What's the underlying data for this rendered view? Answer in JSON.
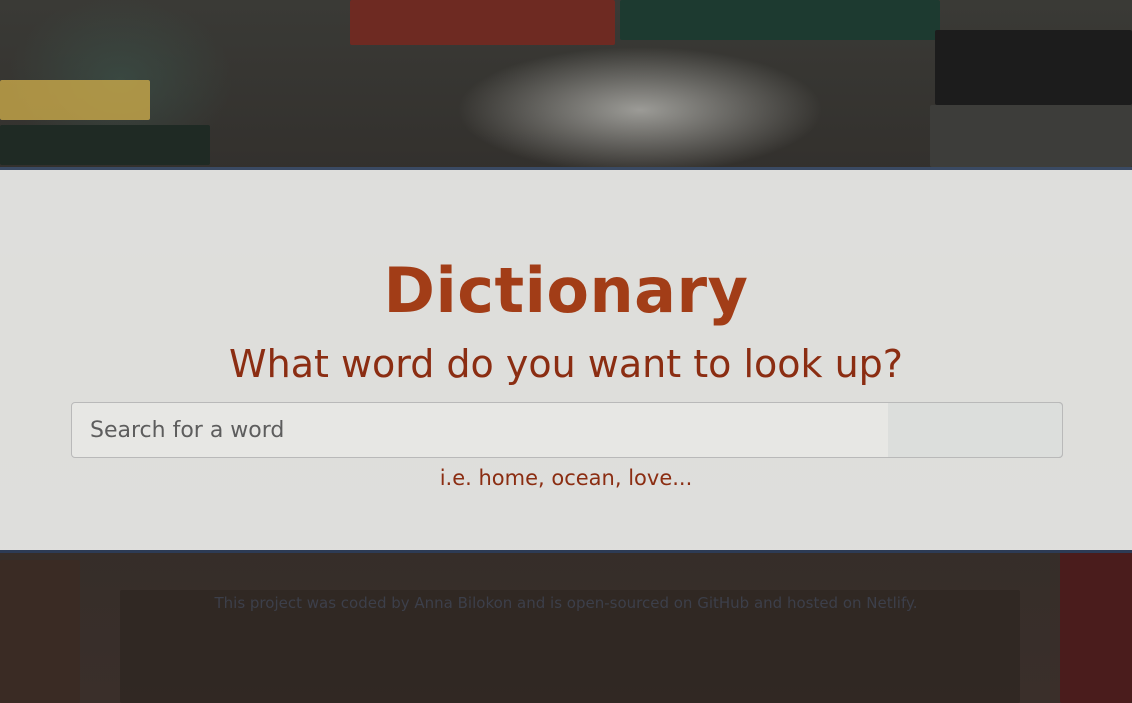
{
  "header": {
    "title": "Dictionary",
    "subtitle": "What word do you want to look up?"
  },
  "search": {
    "placeholder": "Search for a word",
    "value": ""
  },
  "hint": "i.e. home, ocean, love...",
  "footer": {
    "prefix": "This project was coded by ",
    "author_link": "Anna Bilokon",
    "middle": " and is ",
    "github_link": "open-sourced on GitHub",
    "middle2": " and hosted on ",
    "netlify_link": "Netlify",
    "suffix": "."
  },
  "colors": {
    "title": "#a23d17",
    "subtitle": "#8b2d12",
    "panel": "#ececea",
    "panel_border": "#2d3b55"
  }
}
